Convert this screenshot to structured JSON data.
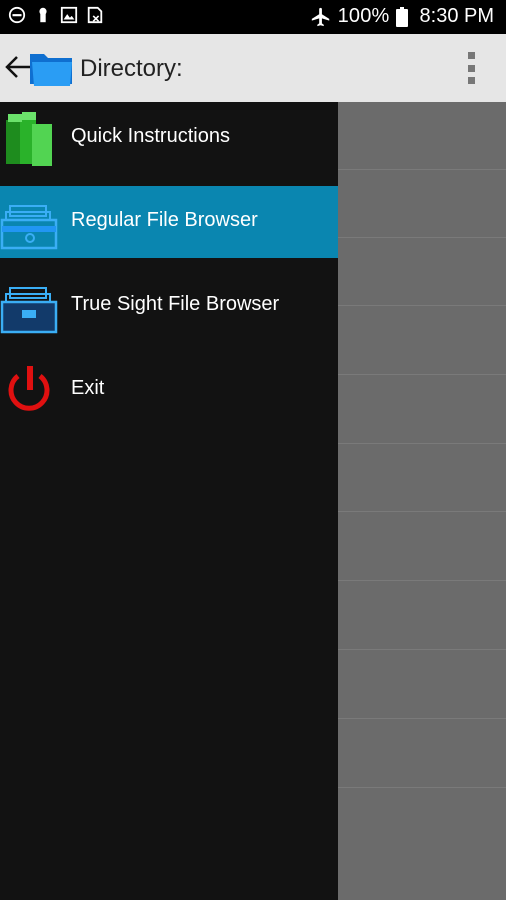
{
  "status_bar": {
    "battery_percent": "100%",
    "time": "8:30 PM",
    "left_icons": [
      "do-not-disturb-icon",
      "keyhole-icon",
      "gallery-icon",
      "sim-card-icon"
    ],
    "right_icons": [
      "airplane-icon",
      "battery-icon"
    ]
  },
  "app_bar": {
    "title": "Directory:",
    "icons": [
      "back-arrow-icon",
      "folder-icon",
      "overflow-menu-icon"
    ],
    "background": "#e6e6e6"
  },
  "drawer": {
    "selected_color": "#0a86b0",
    "background": "#121212",
    "items": [
      {
        "label": "Quick Instructions",
        "icon": "green-binders-icon"
      },
      {
        "label": "Regular File Browser",
        "icon": "open-file-drawer-icon",
        "selected": true
      },
      {
        "label": "True Sight File Browser",
        "icon": "file-cabinet-icon"
      },
      {
        "label": "Exit",
        "icon": "power-icon"
      }
    ]
  }
}
